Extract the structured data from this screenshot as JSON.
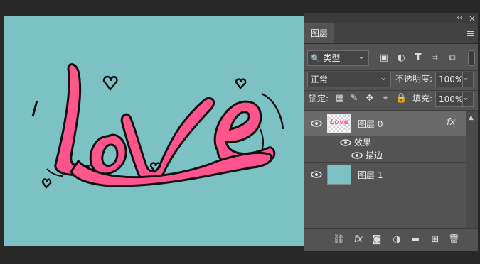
{
  "panel": {
    "collapse_glyph": "‹‹",
    "close_glyph": "×",
    "tab_label": "图层",
    "filter": {
      "value": "类型",
      "icon": "search-icon"
    },
    "blend_mode": "正常",
    "opacity_label": "不透明度:",
    "opacity_value": "100%",
    "lock_label": "锁定:",
    "fill_label": "填充:",
    "fill_value": "100%",
    "filter_icons": [
      "image-filter-icon",
      "adjustment-filter-icon",
      "type-filter-icon",
      "shape-filter-icon",
      "smart-object-filter-icon"
    ],
    "lock_icons": [
      "lock-transparent-icon",
      "lock-paint-icon",
      "lock-move-icon",
      "lock-artboard-icon",
      "lock-all-icon"
    ],
    "type_glyph": "T",
    "layers": [
      {
        "name": "图层 0",
        "fx": "fx",
        "selected": true
      },
      {
        "effects_label": "效果",
        "effect": "描边"
      },
      {
        "name": "图层 1",
        "selected": false
      }
    ],
    "thumb_text": "Love",
    "bottom_icons": [
      "link-layers-icon",
      "fx-icon",
      "layer-mask-icon",
      "adjustment-layer-icon",
      "group-folder-icon",
      "new-layer-icon",
      "trash-icon"
    ],
    "bottom_fx": "fx"
  },
  "colors": {
    "canvas_bg": "#7cc1c4",
    "love_pink": "#ff5a8c",
    "panel_bg": "#535353"
  }
}
